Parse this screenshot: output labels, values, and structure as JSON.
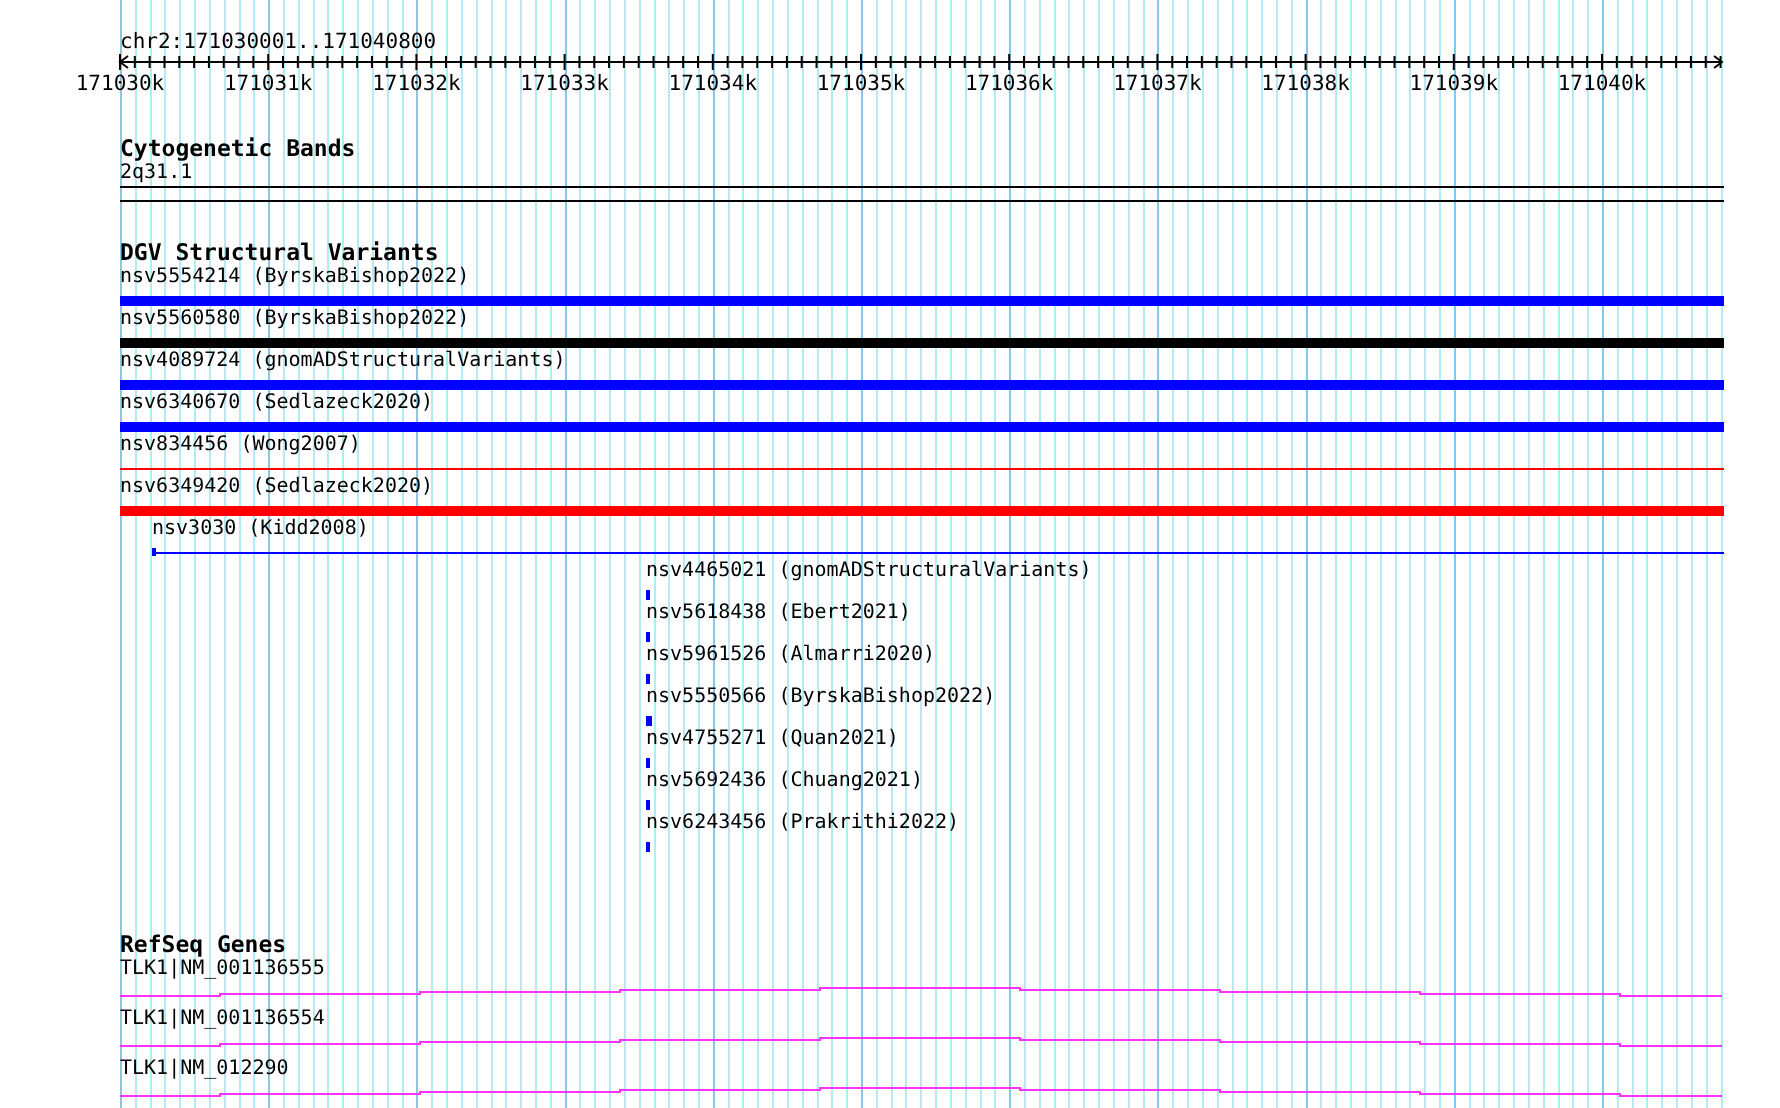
{
  "ruler": {
    "label": "chr2:171030001..171040800",
    "ticks": [
      "171030k",
      "171031k",
      "171032k",
      "171033k",
      "171034k",
      "171035k",
      "171036k",
      "171037k",
      "171038k",
      "171039k",
      "171040k"
    ]
  },
  "tracks": [
    {
      "kind": "bands",
      "title": "Cytogenetic Bands",
      "features": [
        {
          "label": "2q31.1"
        }
      ]
    },
    {
      "kind": "variants",
      "title": "DGV Structural Variants",
      "features": [
        {
          "label": "nsv5554214 (ByrskaBishop2022)",
          "kind": "bar",
          "color": "#0000ff",
          "thick": true
        },
        {
          "label": "nsv5560580 (ByrskaBishop2022)",
          "kind": "bar",
          "color": "#000000",
          "thick": true
        },
        {
          "label": "nsv4089724 (gnomADStructuralVariants)",
          "kind": "bar",
          "color": "#0000ff",
          "thick": true
        },
        {
          "label": "nsv6340670 (Sedlazeck2020)",
          "kind": "bar",
          "color": "#0000ff",
          "thick": true
        },
        {
          "label": "nsv834456 (Wong2007)",
          "kind": "bar",
          "color": "#ff0000",
          "thick": false
        },
        {
          "label": "nsv6349420 (Sedlazeck2020)",
          "kind": "bar",
          "color": "#ff0000",
          "thick": true
        },
        {
          "label": "nsv3030 (Kidd2008)",
          "kind": "capped",
          "color": "#0000ff",
          "thick": false
        },
        {
          "label": "nsv4465021 (gnomADStructuralVariants)",
          "kind": "point",
          "color": "#0000ff",
          "thick": false
        },
        {
          "label": "nsv5618438 (Ebert2021)",
          "kind": "point",
          "color": "#0000ff",
          "thick": false
        },
        {
          "label": "nsv5961526 (Almarri2020)",
          "kind": "point",
          "color": "#0000ff",
          "thick": false
        },
        {
          "label": "nsv5550566 (ByrskaBishop2022)",
          "kind": "point",
          "color": "#0000ff",
          "thick": true
        },
        {
          "label": "nsv4755271 (Quan2021)",
          "kind": "point",
          "color": "#0000ff",
          "thick": false
        },
        {
          "label": "nsv5692436 (Chuang2021)",
          "kind": "point",
          "color": "#0000ff",
          "thick": false
        },
        {
          "label": "nsv6243456 (Prakrithi2022)",
          "kind": "point",
          "color": "#0000ff",
          "thick": false
        }
      ]
    },
    {
      "kind": "genes",
      "title": "RefSeq Genes",
      "features": [
        {
          "label": "TLK1|NM_001136555"
        },
        {
          "label": "TLK1|NM_001136554"
        },
        {
          "label": "TLK1|NM_012290"
        }
      ]
    }
  ]
}
